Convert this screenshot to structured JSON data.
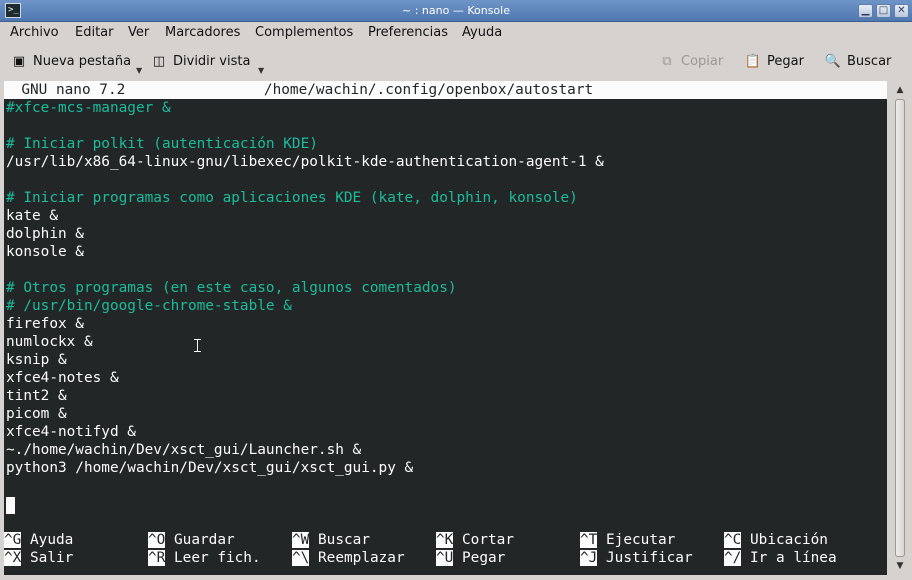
{
  "window": {
    "title": "~ : nano — Konsole",
    "app_icon": ">_"
  },
  "window_buttons": {
    "minimize": "▁",
    "maximize": "□",
    "close": "✕"
  },
  "menu": [
    "Archivo",
    "Editar",
    "Ver",
    "Marcadores",
    "Complementos",
    "Preferencias",
    "Ayuda"
  ],
  "toolbar": {
    "new_tab": "Nueva pestaña",
    "split_view": "Dividir vista",
    "copy": "Copiar",
    "paste": "Pegar",
    "find": "Buscar"
  },
  "icons": {
    "new_tab": "new-tab-icon",
    "split_view": "split-view-icon",
    "copy": "copy-icon",
    "paste": "paste-icon",
    "find": "search-icon",
    "dropdown": "chevron-down-icon"
  },
  "nano": {
    "header": "  GNU nano 7.2                /home/wachin/.config/openbox/autostart",
    "lines": [
      {
        "text": "#xfce-mcs-manager &",
        "comment": true
      },
      {
        "text": "",
        "comment": false
      },
      {
        "text": "# Iniciar polkit (autenticación KDE)",
        "comment": true
      },
      {
        "text": "/usr/lib/x86_64-linux-gnu/libexec/polkit-kde-authentication-agent-1 &",
        "comment": false
      },
      {
        "text": "",
        "comment": false
      },
      {
        "text": "# Iniciar programas como aplicaciones KDE (kate, dolphin, konsole)",
        "comment": true
      },
      {
        "text": "kate &",
        "comment": false
      },
      {
        "text": "dolphin &",
        "comment": false
      },
      {
        "text": "konsole &",
        "comment": false
      },
      {
        "text": "",
        "comment": false
      },
      {
        "text": "# Otros programas (en este caso, algunos comentados)",
        "comment": true
      },
      {
        "text": "# /usr/bin/google-chrome-stable &",
        "comment": true
      },
      {
        "text": "firefox &",
        "comment": false
      },
      {
        "text": "numlockx &",
        "comment": false
      },
      {
        "text": "ksnip &",
        "comment": false
      },
      {
        "text": "xfce4-notes &",
        "comment": false
      },
      {
        "text": "tint2 &",
        "comment": false
      },
      {
        "text": "picom &",
        "comment": false
      },
      {
        "text": "xfce4-notifyd &",
        "comment": false
      },
      {
        "text": "~./home/wachin/Dev/xsct_gui/Launcher.sh &",
        "comment": false
      },
      {
        "text": "python3 /home/wachin/Dev/xsct_gui/xsct_gui.py &",
        "comment": false
      }
    ],
    "shortcuts_row1": [
      {
        "key": "^G",
        "label": "Ayuda"
      },
      {
        "key": "^O",
        "label": "Guardar"
      },
      {
        "key": "^W",
        "label": "Buscar"
      },
      {
        "key": "^K",
        "label": "Cortar"
      },
      {
        "key": "^T",
        "label": "Ejecutar"
      },
      {
        "key": "^C",
        "label": "Ubicación"
      }
    ],
    "shortcuts_row2": [
      {
        "key": "^X",
        "label": "Salir"
      },
      {
        "key": "^R",
        "label": "Leer fich."
      },
      {
        "key": "^\\",
        "label": "Reemplazar"
      },
      {
        "key": "^U",
        "label": "Pegar"
      },
      {
        "key": "^J",
        "label": "Justificar"
      },
      {
        "key": "^/",
        "label": "Ir a línea"
      }
    ]
  },
  "colors": {
    "terminal_bg": "#232627",
    "terminal_fg": "#fcfcfc",
    "comment": "#1abc9c",
    "titlebar": "#5a82bb"
  }
}
